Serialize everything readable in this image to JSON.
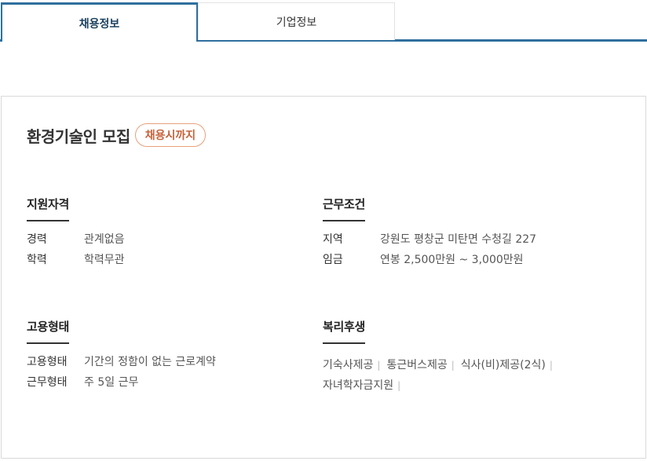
{
  "tabs": [
    {
      "label": "채용정보",
      "active": true
    },
    {
      "label": "기업정보",
      "active": false
    }
  ],
  "job": {
    "title": "환경기술인 모집",
    "deadline_badge": "채용시까지"
  },
  "qualification": {
    "title": "지원자격",
    "rows": [
      {
        "label": "경력",
        "value": "관계없음"
      },
      {
        "label": "학력",
        "value": "학력무관"
      }
    ]
  },
  "conditions": {
    "title": "근무조건",
    "rows": [
      {
        "label": "지역",
        "value": "강원도 평창군 미탄면 수청길 227"
      },
      {
        "label": "임금",
        "value": "연봉 2,500만원 ~ 3,000만원"
      }
    ]
  },
  "employment": {
    "title": "고용형태",
    "rows": [
      {
        "label": "고용형태",
        "value": "기간의 정함이 없는 근로계약"
      },
      {
        "label": "근무형태",
        "value": "주 5일 근무"
      }
    ]
  },
  "benefits": {
    "title": "복리후생",
    "items": [
      "기숙사제공",
      "통근버스제공",
      "식사(비)제공(2식)",
      "자녀학자금지원"
    ],
    "separator": "|"
  },
  "colors": {
    "tab_accent": "#2f6f9e",
    "badge_border": "#e8a07c",
    "badge_text": "#c5623a"
  }
}
